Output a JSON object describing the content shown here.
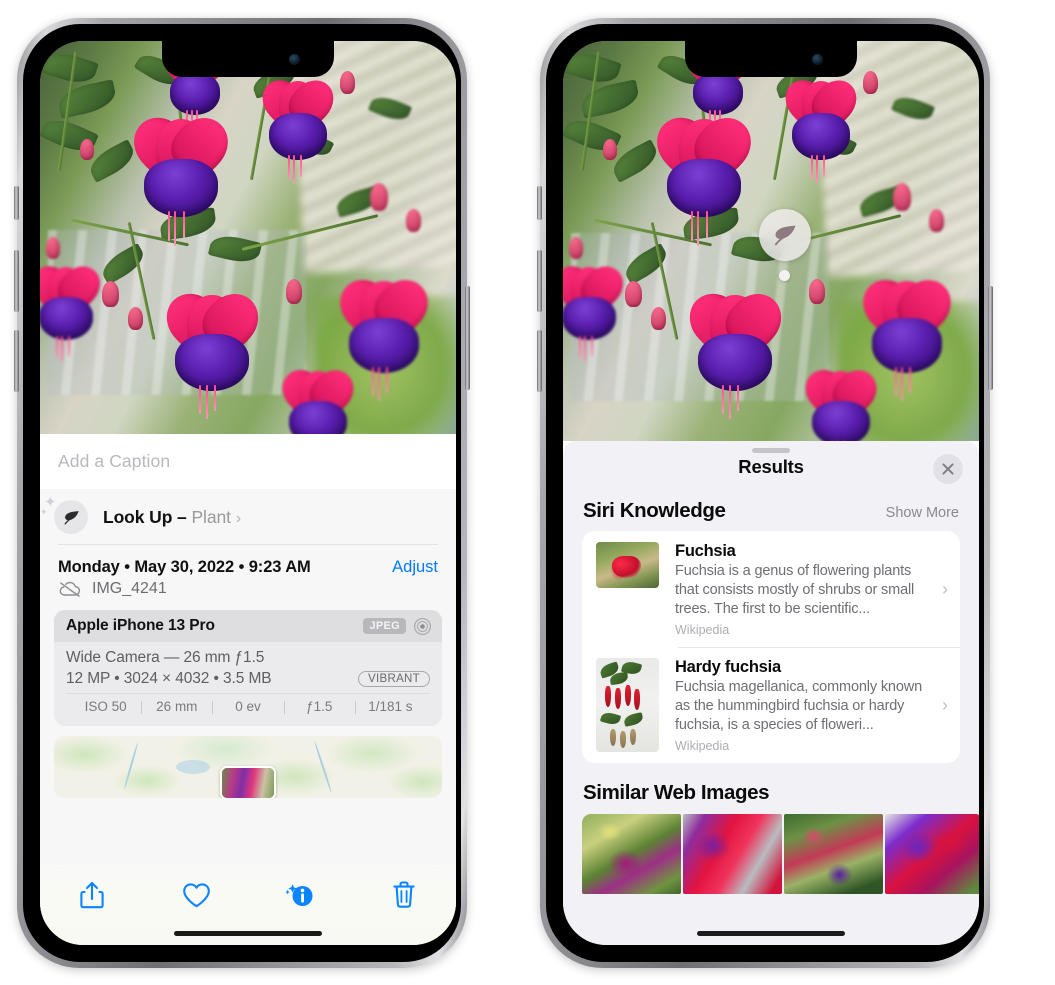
{
  "left_phone": {
    "caption": {
      "placeholder": "Add a Caption",
      "value": ""
    },
    "look_up": {
      "label": "Look Up – ",
      "subject": "Plant",
      "chevron": "›",
      "icon": "leaf-icon"
    },
    "date_row": {
      "date_text": "Monday • May 30, 2022 • 9:23 AM",
      "adjust_label": "Adjust"
    },
    "file_row": {
      "file_name": "IMG_4241",
      "icon": "cloud-slash-icon"
    },
    "exif": {
      "device": "Apple iPhone 13 Pro",
      "format_badge": "JPEG",
      "aperture_icon": "aperture-icon",
      "lens_line": "Wide Camera — 26 mm ƒ1.5",
      "specs_line": "12 MP • 3024 × 4032 • 3.5 MB",
      "style_pill": "VIBRANT",
      "stats": [
        "ISO 50",
        "26 mm",
        "0 ev",
        "ƒ1.5",
        "1/181 s"
      ]
    },
    "toolbar": [
      {
        "name": "share-button",
        "icon": "share-icon"
      },
      {
        "name": "favorite-button",
        "icon": "heart-icon"
      },
      {
        "name": "info-button",
        "icon": "info-sparkle-icon"
      },
      {
        "name": "delete-button",
        "icon": "trash-icon"
      }
    ]
  },
  "right_phone": {
    "badge": {
      "icon": "leaf-icon",
      "name": "visual-look-up-badge"
    },
    "sheet": {
      "title": "Results",
      "close_icon": "close-icon",
      "siri_section": {
        "title": "Siri Knowledge",
        "show_more": "Show More",
        "items": [
          {
            "title": "Fuchsia",
            "snippet": "Fuchsia is a genus of flowering plants that consists mostly of shrubs or small trees. The first to be scientific...",
            "source": "Wikipedia",
            "chevron": "›"
          },
          {
            "title": "Hardy fuchsia",
            "snippet": "Fuchsia magellanica, commonly known as the hummingbird fuchsia or hardy fuchsia, is a species of floweri...",
            "source": "Wikipedia",
            "chevron": "›"
          }
        ]
      },
      "web_section": {
        "title": "Similar Web Images",
        "tiles": [
          {
            "name": "web-image-1"
          },
          {
            "name": "web-image-2"
          },
          {
            "name": "web-image-3"
          },
          {
            "name": "web-image-4"
          }
        ]
      }
    }
  },
  "colors": {
    "accent_blue": "#007aff",
    "sheet_bg": "#f2f1f6",
    "panel_bg": "#f7f7f7",
    "card_bg": "#ebebed"
  }
}
